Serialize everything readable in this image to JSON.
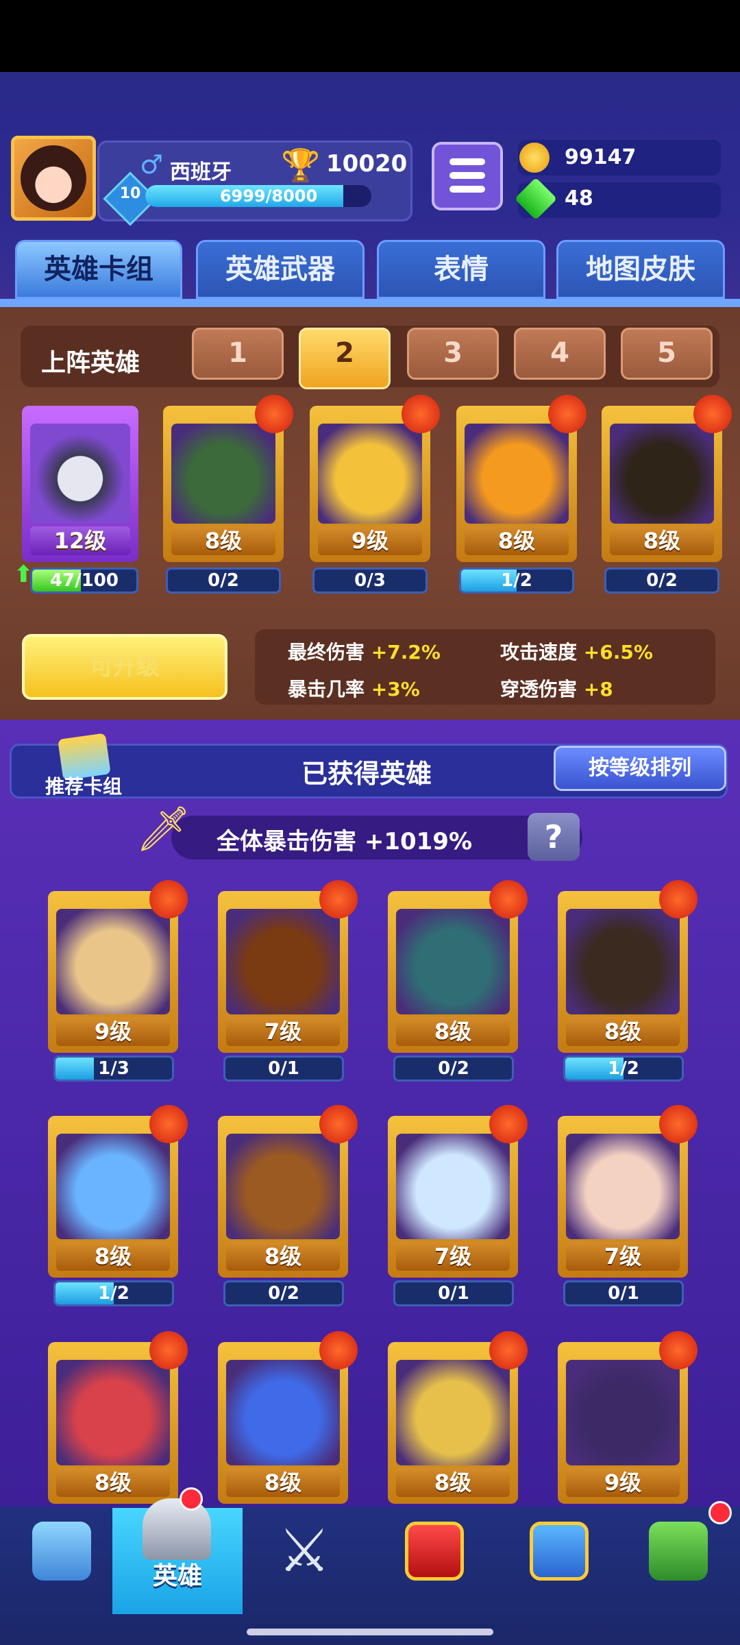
{
  "player": {
    "name": "西班牙",
    "gender_icon": "♂",
    "trophies": "10020",
    "level": "10",
    "xp_text": "6999/8000",
    "xp_fraction": 0.875
  },
  "currency": {
    "gold": "99147",
    "gems": "48"
  },
  "tabs": [
    "英雄卡组",
    "英雄武器",
    "表情",
    "地图皮肤"
  ],
  "lineup": {
    "label": "上阵英雄",
    "slots": [
      "1",
      "2",
      "3",
      "4",
      "5"
    ],
    "active_slot": 2
  },
  "featured_hero": {
    "level": "12级",
    "progress": "47/100",
    "progress_fraction": 0.47
  },
  "lineup_cards": [
    {
      "level": "8级",
      "progress": "0/2",
      "fraction": 0
    },
    {
      "level": "9级",
      "progress": "0/3",
      "fraction": 0
    },
    {
      "level": "8级",
      "progress": "1/2",
      "fraction": 0.5
    },
    {
      "level": "8级",
      "progress": "0/2",
      "fraction": 0
    }
  ],
  "upgrade_label": "可升级",
  "stats": {
    "final_damage_label": "最终伤害",
    "final_damage": "+7.2%",
    "attack_speed_label": "攻击速度",
    "attack_speed": "+6.5%",
    "crit_rate_label": "暴击几率",
    "crit_rate": "+3%",
    "pierce_label": "穿透伤害",
    "pierce": "+8"
  },
  "collection": {
    "recommended": "推荐卡组",
    "title": "已获得英雄",
    "sort": "按等级排列"
  },
  "crit_bonus": {
    "label": "全体暴击伤害",
    "value": "+1019%"
  },
  "hero_grid": [
    {
      "level": "9级",
      "progress": "1/3",
      "fraction": 0.33
    },
    {
      "level": "7级",
      "progress": "0/1",
      "fraction": 0
    },
    {
      "level": "8级",
      "progress": "0/2",
      "fraction": 0
    },
    {
      "level": "8级",
      "progress": "1/2",
      "fraction": 0.5
    },
    {
      "level": "8级",
      "progress": "1/2",
      "fraction": 0.5
    },
    {
      "level": "8级",
      "progress": "0/2",
      "fraction": 0
    },
    {
      "level": "7级",
      "progress": "0/1",
      "fraction": 0
    },
    {
      "level": "7级",
      "progress": "0/1",
      "fraction": 0
    },
    {
      "level": "8级"
    },
    {
      "level": "8级"
    },
    {
      "level": "8级"
    },
    {
      "level": "9级"
    }
  ],
  "nav": {
    "heroes_label": "英雄"
  }
}
